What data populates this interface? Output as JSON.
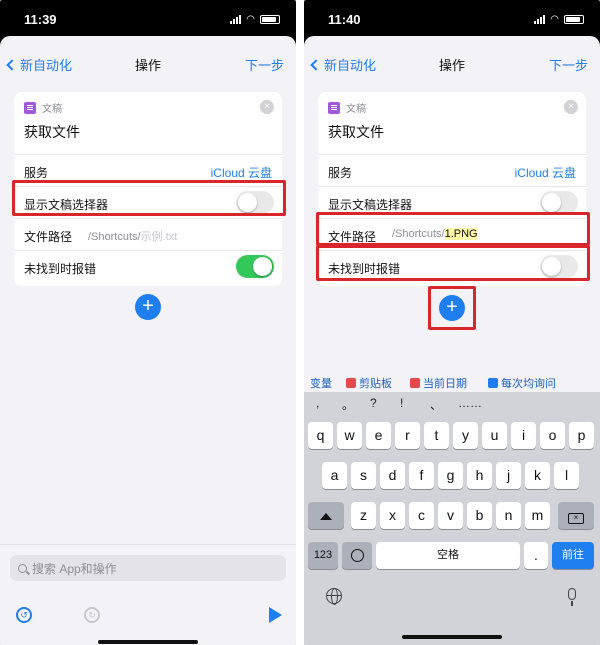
{
  "left": {
    "status": {
      "time": "11:39"
    },
    "nav": {
      "back": "新自动化",
      "title": "操作",
      "next": "下一步"
    },
    "action": {
      "app_name": "文稿",
      "title": "获取文件",
      "service_label": "服务",
      "service_value": "iCloud 云盘",
      "picker_label": "显示文稿选择器",
      "picker_on": false,
      "path_label": "文件路径",
      "path_prefix": "/Shortcuts/",
      "path_placeholder": "示例.txt",
      "error_label": "未找到时报错",
      "error_on": true
    },
    "search_placeholder": "搜索 App和操作"
  },
  "right": {
    "status": {
      "time": "11:40"
    },
    "nav": {
      "back": "新自动化",
      "title": "操作",
      "next": "下一步"
    },
    "action": {
      "app_name": "文稿",
      "title": "获取文件",
      "service_label": "服务",
      "service_value": "iCloud 云盘",
      "picker_label": "显示文稿选择器",
      "picker_on": false,
      "path_label": "文件路径",
      "path_prefix": "/Shortcuts/",
      "path_typed": "1.PNG",
      "error_label": "未找到时报错",
      "error_on": false
    },
    "suggestions": [
      {
        "label": "变量",
        "icon": ""
      },
      {
        "label": "剪贴板",
        "icon": "clipboard-icon"
      },
      {
        "label": "当前日期",
        "icon": "calendar-icon"
      },
      {
        "label": "每次均询问",
        "icon": "ask-icon"
      }
    ],
    "keyboard": {
      "punct": [
        ",",
        "。",
        "?",
        "!",
        "、",
        "……"
      ],
      "row1": [
        "q",
        "w",
        "e",
        "r",
        "t",
        "y",
        "u",
        "i",
        "o",
        "p"
      ],
      "row2": [
        "a",
        "s",
        "d",
        "f",
        "g",
        "h",
        "j",
        "k",
        "l"
      ],
      "row3": [
        "z",
        "x",
        "c",
        "v",
        "b",
        "n",
        "m"
      ],
      "num_key": "123",
      "space": "空格",
      "dot": ".",
      "go": "前往"
    }
  },
  "colors": {
    "accent": "#1f7ff0",
    "highlight": "#d9262a",
    "toggle_on": "#34c759"
  }
}
